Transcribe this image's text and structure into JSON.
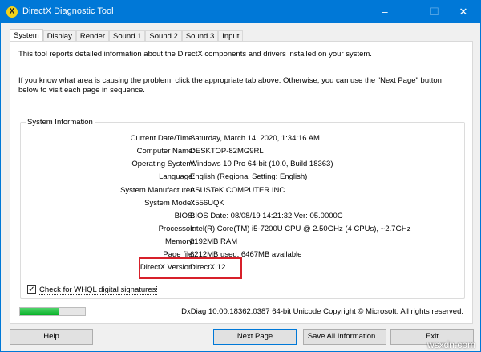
{
  "window": {
    "title": "DirectX Diagnostic Tool",
    "minimize": "–",
    "maximize": "☐",
    "close": "✕"
  },
  "tabs": [
    "System",
    "Display",
    "Render",
    "Sound 1",
    "Sound 2",
    "Sound 3",
    "Input"
  ],
  "intro": "This tool reports detailed information about the DirectX components and drivers installed on your system.",
  "hint": "If you know what area is causing the problem, click the appropriate tab above.  Otherwise, you can use the \"Next Page\" button below to visit each page in sequence.",
  "group_title": "System Information",
  "info": [
    {
      "k": "Current Date/Time:",
      "v": "Saturday, March 14, 2020, 1:34:16 AM"
    },
    {
      "k": "Computer Name:",
      "v": "DESKTOP-82MG9RL"
    },
    {
      "k": "Operating System:",
      "v": "Windows 10 Pro 64-bit (10.0, Build 18363)"
    },
    {
      "k": "Language:",
      "v": "English (Regional Setting: English)"
    },
    {
      "k": "System Manufacturer:",
      "v": "ASUSTeK COMPUTER INC."
    },
    {
      "k": "System Model:",
      "v": "X556UQK"
    },
    {
      "k": "BIOS:",
      "v": "BIOS Date: 08/08/19 14:21:32 Ver: 05.0000C"
    },
    {
      "k": "Processor:",
      "v": "Intel(R) Core(TM) i5-7200U CPU @ 2.50GHz (4 CPUs), ~2.7GHz"
    },
    {
      "k": "Memory:",
      "v": "8192MB RAM"
    },
    {
      "k": "Page file:",
      "v": "6212MB used, 6467MB available"
    },
    {
      "k": "DirectX Version:",
      "v": "DirectX 12"
    }
  ],
  "whql": {
    "label": "Check for WHQL digital signatures",
    "checked": true
  },
  "progress_percent": 60,
  "copyright": "DxDiag 10.00.18362.0387 64-bit Unicode  Copyright © Microsoft. All rights reserved.",
  "buttons": {
    "help": "Help",
    "next": "Next Page",
    "save": "Save All Information...",
    "exit": "Exit"
  },
  "watermark": "wsxdn.com"
}
